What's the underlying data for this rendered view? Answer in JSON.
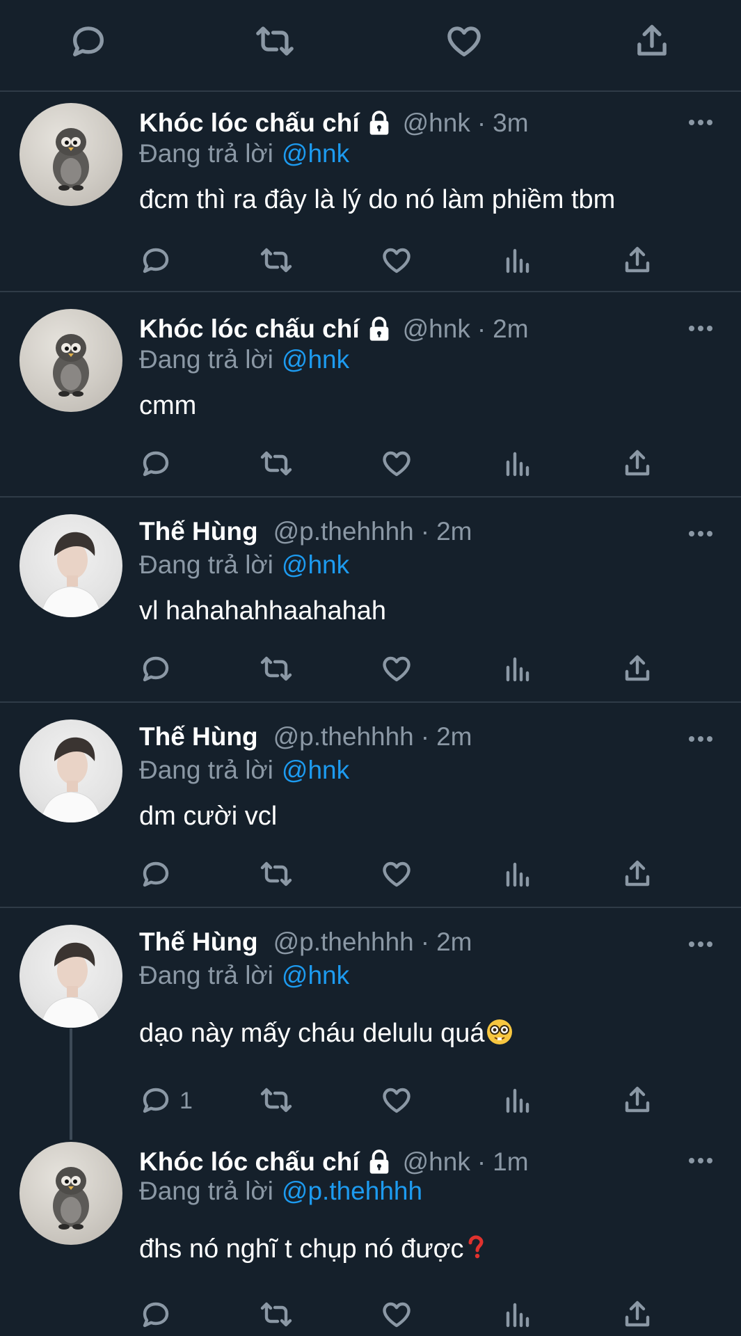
{
  "colors": {
    "background": "#15202b",
    "divider": "#2f3b47",
    "muted": "#8b98a5",
    "mention": "#1d9bf0",
    "text": "#ffffff"
  },
  "icons": [
    "reply-icon",
    "retweet-icon",
    "like-icon",
    "views-icon",
    "share-icon",
    "more-icon",
    "lock-icon"
  ],
  "tweets": [
    {
      "name": "Khóc lóc chấu chí",
      "locked": true,
      "handle": "@hnk",
      "dot": "·",
      "time": "3m",
      "reply_prefix": "Đang trả lời",
      "reply_to": "@hnk",
      "text": "đcm thì ra đây là lý do nó làm phiềm tbm",
      "avatar": "penguin-avatar"
    },
    {
      "name": "Khóc lóc chấu chí",
      "locked": true,
      "handle": "@hnk",
      "dot": "·",
      "time": "2m",
      "reply_prefix": "Đang trả lời",
      "reply_to": "@hnk",
      "text": "cmm",
      "avatar": "penguin-avatar"
    },
    {
      "name": "Thế Hùng",
      "locked": false,
      "handle": "@p.thehhhh",
      "dot": "·",
      "time": "2m",
      "reply_prefix": "Đang trả lời",
      "reply_to": "@hnk",
      "text": "vl hahahahhaahahah",
      "avatar": "person-avatar"
    },
    {
      "name": "Thế Hùng",
      "locked": false,
      "handle": "@p.thehhhh",
      "dot": "·",
      "time": "2m",
      "reply_prefix": "Đang trả lời",
      "reply_to": "@hnk",
      "text": "dm cười vcl",
      "avatar": "person-avatar"
    },
    {
      "name": "Thế Hùng",
      "locked": false,
      "handle": "@p.thehhhh",
      "dot": "·",
      "time": "2m",
      "reply_prefix": "Đang trả lời",
      "reply_to": "@hnk",
      "text": "dạo này mấy cháu delulu quá",
      "emoji": "nerd-face-emoji",
      "reply_count": "1",
      "avatar": "person-avatar"
    },
    {
      "name": "Khóc lóc chấu chí",
      "locked": true,
      "handle": "@hnk",
      "dot": "·",
      "time": "1m",
      "reply_prefix": "Đang trả lời",
      "reply_to": "@p.thehhhh",
      "text": "đhs nó nghĩ t chụp nó được",
      "emoji": "red-question-mark-emoji",
      "avatar": "penguin-avatar"
    }
  ]
}
